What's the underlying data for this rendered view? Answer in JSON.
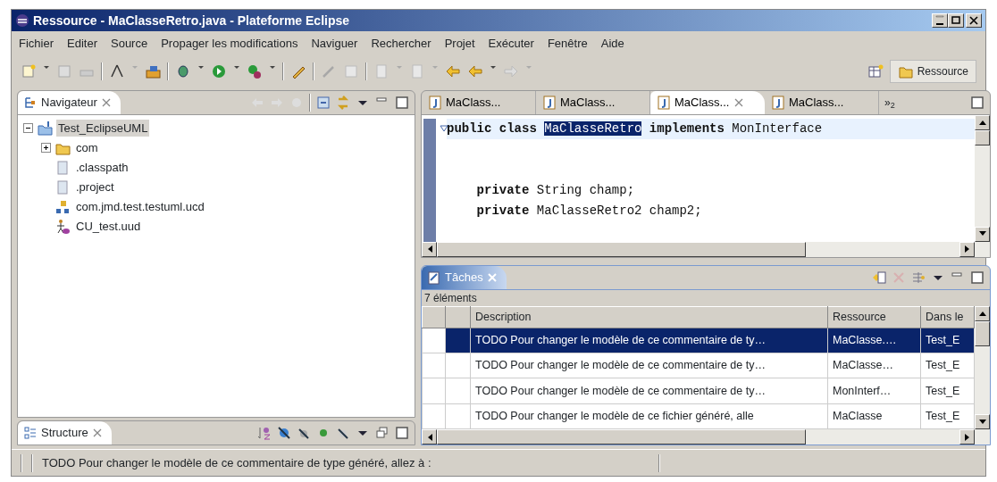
{
  "window": {
    "title": "Ressource - MaClasseRetro.java - Plateforme Eclipse"
  },
  "menu": [
    "Fichier",
    "Editer",
    "Source",
    "Propager les modifications",
    "Naviguer",
    "Rechercher",
    "Projet",
    "Exécuter",
    "Fenêtre",
    "Aide"
  ],
  "perspective": {
    "label": "Ressource",
    "selected": true
  },
  "navigator": {
    "title": "Navigateur",
    "tree": [
      {
        "label": "Test_EclipseUML",
        "kind": "project",
        "expanded": true,
        "selected": true,
        "children": [
          {
            "label": "com",
            "kind": "folder",
            "expanded": false,
            "selected": false
          },
          {
            "label": ".classpath",
            "kind": "file",
            "selected": false
          },
          {
            "label": ".project",
            "kind": "file",
            "selected": false
          },
          {
            "label": "com.jmd.test.testuml.ucd",
            "kind": "diagram",
            "selected": false
          },
          {
            "label": "CU_test.uud",
            "kind": "usecase",
            "selected": false
          }
        ]
      }
    ]
  },
  "structure": {
    "title": "Structure"
  },
  "editor": {
    "tabs": [
      {
        "label": "MaClass...",
        "selected": false
      },
      {
        "label": "MaClass...",
        "selected": false
      },
      {
        "label": "MaClass...",
        "selected": true
      },
      {
        "label": "MaClass...",
        "selected": false
      }
    ],
    "overflow": "»$_{2}$",
    "lines": [
      {
        "kind": "code",
        "before": "**public class** ",
        "selection": "MaClasseRetro",
        "after": " **implements** MonInterface",
        "folded": false
      },
      {
        "kind": "blank"
      },
      {
        "kind": "blank"
      },
      {
        "kind": "code",
        "before": "    **private** String champ;"
      },
      {
        "kind": "code",
        "before": "    **private** MaClasseRetro2 champ2;"
      }
    ]
  },
  "tasks": {
    "title": "Tâches",
    "count": "7 éléments",
    "columns": [
      "Description",
      "Ressource",
      "Dans le"
    ],
    "rows": [
      {
        "selected": true,
        "cells": [
          "TODO Pour changer le modèle de ce commentaire de ty…",
          "MaClasse.…",
          "Test_E"
        ]
      },
      {
        "selected": false,
        "cells": [
          "TODO Pour changer le modèle de ce commentaire de ty…",
          "MaClasse…",
          "Test_E"
        ]
      },
      {
        "selected": false,
        "cells": [
          "TODO Pour changer le modèle de ce commentaire de ty…",
          "MonInterf…",
          "Test_E"
        ]
      },
      {
        "selected": false,
        "cells": [
          "TODO Pour changer le modèle de ce fichier généré, alle",
          "MaClasse",
          "Test_E"
        ]
      }
    ]
  },
  "status_bar": "TODO Pour changer le modèle de ce commentaire de type généré, allez à :"
}
